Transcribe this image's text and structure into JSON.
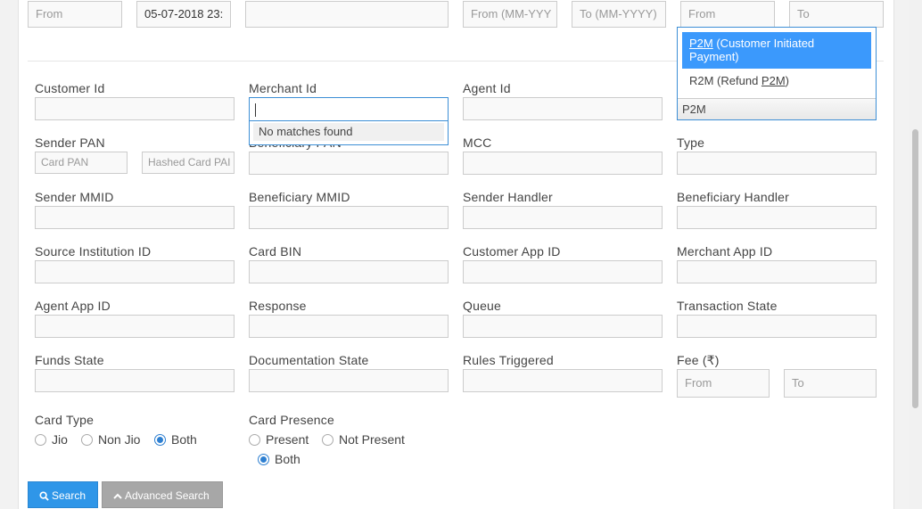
{
  "top_row": {
    "date_from_placeholder": "From",
    "date_to_value": "05-07-2018 23:",
    "month_from_placeholder": "From (MM-YYY",
    "month_to_placeholder": "To (MM-YYYY)",
    "amount_from_placeholder": "From",
    "amount_to_placeholder": "To"
  },
  "labels": {
    "customer_id": "Customer Id",
    "merchant_id": "Merchant Id",
    "agent_id": "Agent Id",
    "sender_pan": "Sender PAN",
    "beneficiary_pan": "Beneficiary PAN",
    "mcc": "MCC",
    "type": "Type",
    "sender_mmid": "Sender MMID",
    "beneficiary_mmid": "Beneficiary MMID",
    "sender_handler": "Sender Handler",
    "beneficiary_handler": "Beneficiary Handler",
    "source_institution_id": "Source Institution ID",
    "card_bin": "Card BIN",
    "customer_app_id": "Customer App ID",
    "merchant_app_id": "Merchant App ID",
    "agent_app_id": "Agent App ID",
    "response": "Response",
    "queue": "Queue",
    "transaction_state": "Transaction State",
    "funds_state": "Funds State",
    "documentation_state": "Documentation State",
    "rules_triggered": "Rules Triggered",
    "fee": "Fee (₹)",
    "card_type": "Card Type",
    "card_presence": "Card Presence"
  },
  "placeholders": {
    "card_pan": "Card PAN",
    "hashed_card_pan": "Hashed Card PAI",
    "fee_from": "From",
    "fee_to": "To"
  },
  "merchant_search": {
    "no_matches": "No matches found"
  },
  "type_dropdown": {
    "option1_code": "P2M",
    "option1_rest": " (Customer Initiated Payment)",
    "option2_prefix": "R2M (Refund ",
    "option2_code": "P2M",
    "option2_suffix": ")",
    "selected": "P2M"
  },
  "card_type": {
    "options": [
      "Jio",
      "Non Jio",
      "Both"
    ],
    "selected": "Both"
  },
  "card_presence": {
    "options": [
      "Present",
      "Not Present",
      "Both"
    ],
    "selected": "Both"
  },
  "buttons": {
    "search": "Search",
    "advanced_search": "Advanced Search"
  },
  "colors": {
    "primary": "#2f96e8",
    "highlight": "#3b99fc",
    "focus_border": "#3d8fd6"
  }
}
